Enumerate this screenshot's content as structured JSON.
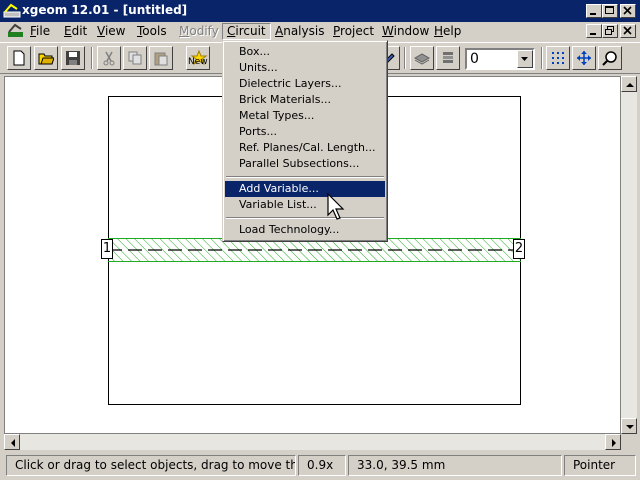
{
  "window": {
    "title": "xgeom 12.01 - [untitled]"
  },
  "menubar": {
    "items": [
      {
        "label": "File",
        "u": "F"
      },
      {
        "label": "Edit",
        "u": "E"
      },
      {
        "label": "View",
        "u": "V"
      },
      {
        "label": "Tools",
        "u": "T"
      },
      {
        "label": "Modify",
        "u": "M"
      },
      {
        "label": "Circuit",
        "u": "C"
      },
      {
        "label": "Analysis",
        "u": "A"
      },
      {
        "label": "Project",
        "u": "P"
      },
      {
        "label": "Window",
        "u": "W"
      },
      {
        "label": "Help",
        "u": "H"
      }
    ]
  },
  "toolbar": {
    "new_label": "New",
    "level_value": "0"
  },
  "circuit_menu": {
    "items": [
      {
        "label": "Box..."
      },
      {
        "label": "Units..."
      },
      {
        "label": "Dielectric Layers..."
      },
      {
        "label": "Brick Materials..."
      },
      {
        "label": "Metal Types..."
      },
      {
        "label": "Ports..."
      },
      {
        "label": "Ref. Planes/Cal. Length..."
      },
      {
        "label": "Parallel Subsections..."
      },
      {
        "label": "Add Variable..."
      },
      {
        "label": "Variable List..."
      },
      {
        "label": "Load Technology..."
      }
    ],
    "selected": "Add Variable..."
  },
  "canvas": {
    "port_left": "1",
    "port_right": "2",
    "metal_color": "#22aa22"
  },
  "statusbar": {
    "hint": "Click or drag to select objects, drag to move them",
    "zoom": "0.9x",
    "coords": "33.0, 39.5 mm",
    "mode": "Pointer"
  },
  "colors": {
    "titlebar": "#0a246a",
    "chrome": "#d4d0c8",
    "selection": "#0a246a"
  }
}
